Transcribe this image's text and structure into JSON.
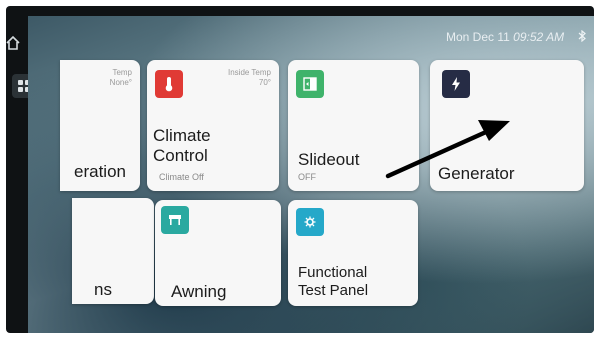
{
  "status": {
    "date": "Mon Dec 11",
    "time": "09:52 AM"
  },
  "tiles": {
    "generation": {
      "title": "eration",
      "corner_line1": "Temp",
      "corner_line2": "None°"
    },
    "climate": {
      "title_line1": "Climate",
      "title_line2": "Control",
      "status": "Climate Off",
      "corner_line1": "Inside Temp",
      "corner_line2": "70°",
      "accent": "#e03a35"
    },
    "slideout": {
      "title": "Slideout",
      "status": "OFF",
      "accent": "#3fb36b"
    },
    "generator": {
      "title": "Generator",
      "accent": "#262c45"
    },
    "partial": {
      "title": "ns"
    },
    "awning": {
      "title": "Awning",
      "accent": "#2aa9a0"
    },
    "functional": {
      "title_line1": "Functional",
      "title_line2": "Test Panel",
      "accent": "#25a8c9"
    }
  },
  "icons": {
    "home": "home-icon",
    "apps": "apps-grid-icon",
    "bluetooth": "bluetooth-icon",
    "bell": "bell-icon",
    "settings": "gear-icon",
    "screen": "screen-icon",
    "thermometer": "thermometer-icon",
    "slideout": "slideout-icon",
    "bolt": "bolt-icon",
    "awning": "awning-icon",
    "functional": "settings-icon"
  }
}
